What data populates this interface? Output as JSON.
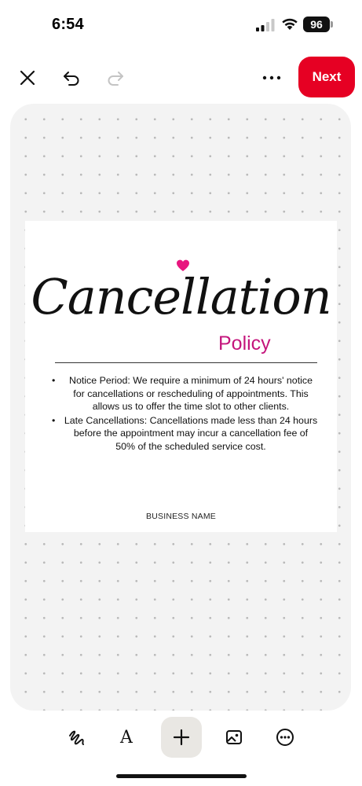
{
  "status_bar": {
    "time": "6:54",
    "battery": "96",
    "signal_icon": "cellular-signal-icon",
    "wifi_icon": "wifi-icon"
  },
  "toolbar": {
    "close_icon": "close-icon",
    "undo_icon": "undo-icon",
    "redo_icon": "redo-icon",
    "more_icon": "more-horizontal-icon",
    "next_label": "Next"
  },
  "design": {
    "title": "Cancellation",
    "subtitle": "Policy",
    "items": [
      {
        "bullet": "•",
        "text": "Notice Period: We require a minimum of 24 hours' notice for cancellations or rescheduling of appointments. This allows us to offer the time slot to other clients."
      },
      {
        "bullet": "•",
        "text": "Late Cancellations: Cancellations made less than 24 hours before the appointment may incur a cancellation fee of 50% of the scheduled service cost."
      }
    ],
    "business_name": "BUSINESS NAME"
  },
  "bottom_tools": [
    {
      "icon": "draw-icon"
    },
    {
      "icon": "text-icon",
      "glyph": "A"
    },
    {
      "icon": "add-icon"
    },
    {
      "icon": "image-icon"
    },
    {
      "icon": "more-circle-icon"
    }
  ],
  "colors": {
    "accent": "#e60023",
    "subtitle": "#c4157c",
    "canvas_bg": "#f3f3f3",
    "add_button_bg": "#e9e7e3"
  }
}
